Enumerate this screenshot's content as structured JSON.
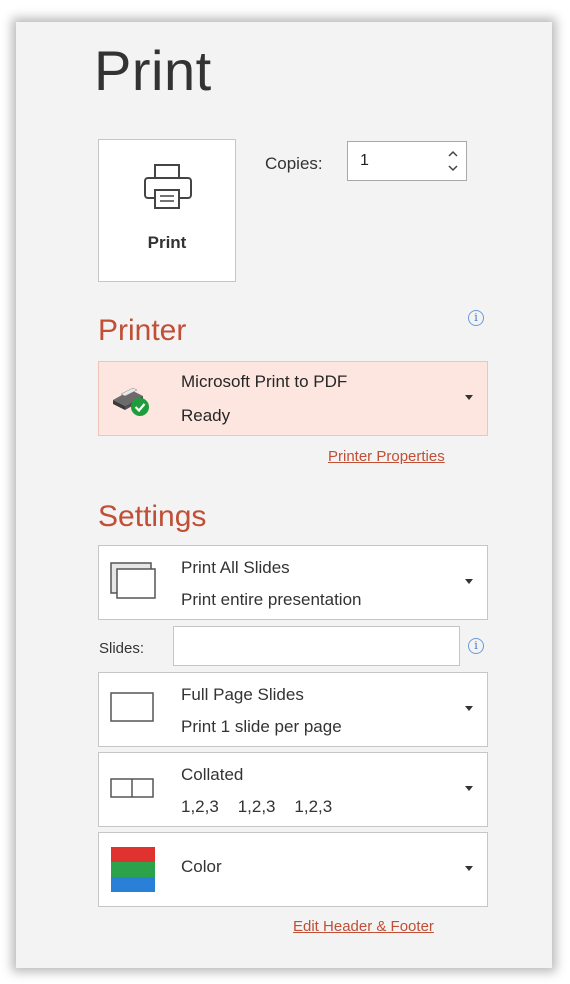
{
  "title": "Print",
  "print_button": {
    "label": "Print",
    "icon": "printer-icon"
  },
  "copies": {
    "label": "Copies:",
    "value": "1"
  },
  "printer": {
    "heading": "Printer",
    "name": "Microsoft Print to PDF",
    "status": "Ready",
    "properties_link": "Printer Properties"
  },
  "settings": {
    "heading": "Settings",
    "slides_scope": {
      "title": "Print All Slides",
      "subtitle": "Print entire presentation"
    },
    "slides_field": {
      "label": "Slides:",
      "value": ""
    },
    "layout": {
      "title": "Full Page Slides",
      "subtitle": "Print 1 slide per page"
    },
    "collation": {
      "title": "Collated",
      "subtitle": "1,2,3    1,2,3    1,2,3"
    },
    "color": {
      "title": "Color"
    },
    "header_footer_link": "Edit Header & Footer"
  },
  "colors": {
    "accent": "#c04f36",
    "printer_bg": "#fde6e0",
    "ready_green": "#1e9e3a"
  }
}
